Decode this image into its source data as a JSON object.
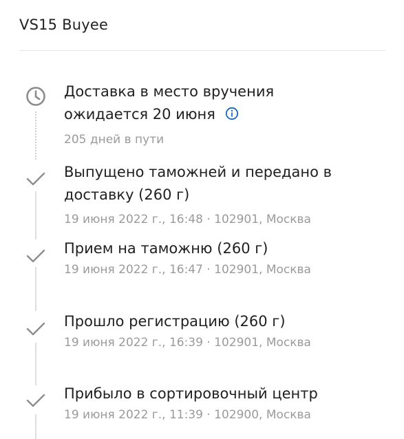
{
  "header": {
    "title": "VS15 Buyee"
  },
  "colors": {
    "text": "#1f1f1f",
    "muted": "#9a9a9a",
    "icon": "#8c8c8c",
    "info_accent": "#1565c0"
  },
  "delivery": {
    "line1": "Доставка в место вручения",
    "line2": "ожидается 20 июня",
    "days_in_transit": "205 дней в пути",
    "status_icon": "clock-icon",
    "info_icon": "info-icon"
  },
  "events": [
    {
      "title_line1": "Выпущено таможней и передано в",
      "title_line2": "доставку (260 г)",
      "details": "19 июня 2022 г., 16:48 · 102901, Москва",
      "icon": "check-icon"
    },
    {
      "title_line1": "Прием на таможню (260 г)",
      "details": "19 июня 2022 г., 16:47 · 102901, Москва",
      "icon": "check-icon"
    },
    {
      "title_line1": "Прошло регистрацию (260 г)",
      "details": "19 июня 2022 г., 16:39 · 102901, Москва",
      "icon": "check-icon"
    },
    {
      "title_line1": "Прибыло в сортировочный центр",
      "details": "19 июня 2022 г., 11:39 · 102900, Москва",
      "icon": "check-icon"
    }
  ]
}
